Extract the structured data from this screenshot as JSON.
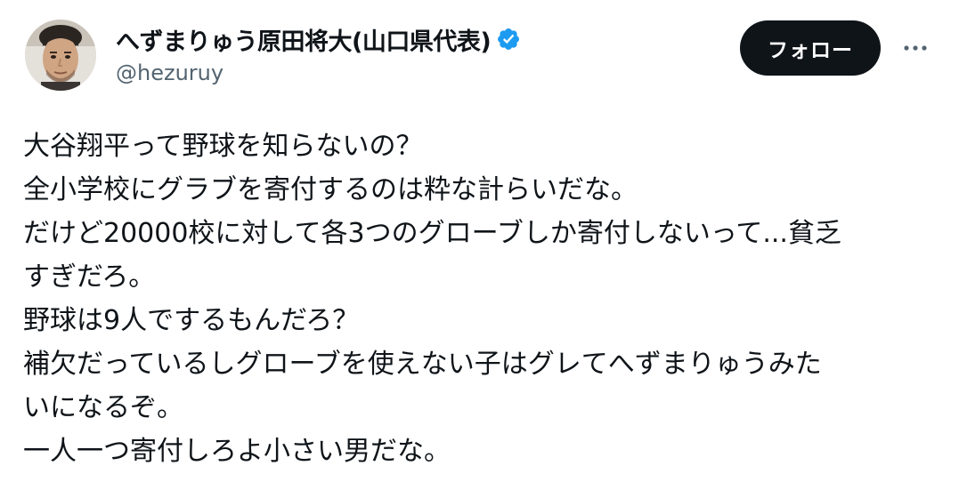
{
  "author": {
    "display_name": "へずまりゅう原田将大(山口県代表)",
    "handle": "@hezuruy",
    "avatar_icon": "avatar-photo",
    "verified_icon": "verified-badge-icon",
    "verified_color": "#1d9bf0"
  },
  "actions": {
    "follow_label": "フォロー",
    "more_icon": "more-options-icon"
  },
  "tweet": {
    "lines": [
      "大谷翔平って野球を知らないの？",
      "全小学校にグラブを寄付するのは粋な計らいだな。",
      "だけど20000校に対して各3つのグローブしか寄付しないって...貧乏",
      "すぎだろ。",
      "野球は9人でするもんだろ？",
      "補欠だっているしグローブを使えない子はグレてへずまりゅうみた",
      "いになるぞ。",
      "一人一つ寄付しろよ小さい男だな。"
    ]
  },
  "colors": {
    "text_primary": "#0f1419",
    "text_secondary": "#536471",
    "button_bg": "#0f1419",
    "button_text": "#ffffff"
  }
}
